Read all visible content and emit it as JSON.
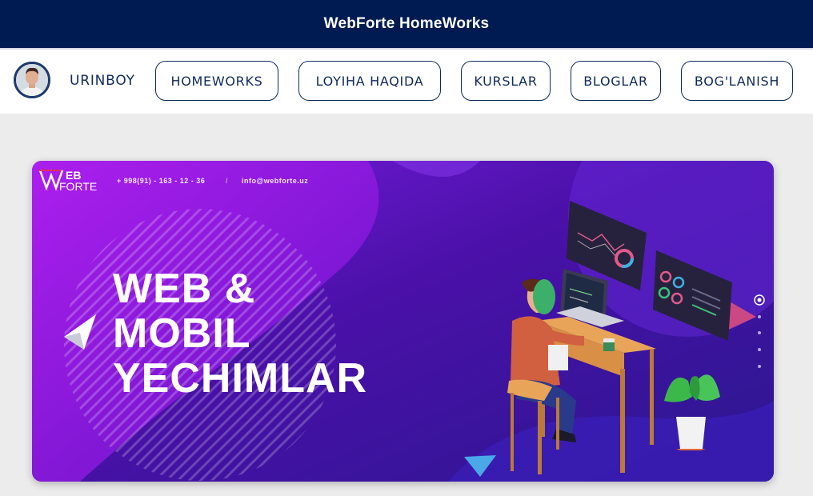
{
  "header": {
    "title": "WebForte HomeWorks"
  },
  "nav": {
    "username": "URINBOY",
    "items": [
      {
        "label": "HOMEWORKS"
      },
      {
        "label": "LOYIHA HAQIDA"
      },
      {
        "label": "KURSLAR"
      },
      {
        "label": "BLOGLAR"
      },
      {
        "label": "BOG'LANISH"
      }
    ]
  },
  "banner": {
    "logo": "WEB FORTE",
    "logo_line1": "EB",
    "logo_line2": "FORTE",
    "phone": "+ 998(91) - 163 - 12 - 36",
    "separator": "/",
    "email": "info@webforte.uz",
    "headline": [
      "WEB &",
      "MOBIL",
      "YECHIMLAR"
    ],
    "slide_indicators": 5,
    "active_slide": 1
  },
  "colors": {
    "header_bg": "#001b51",
    "nav_text": "#0f2a5a",
    "banner_purple": "#5a16c8"
  }
}
